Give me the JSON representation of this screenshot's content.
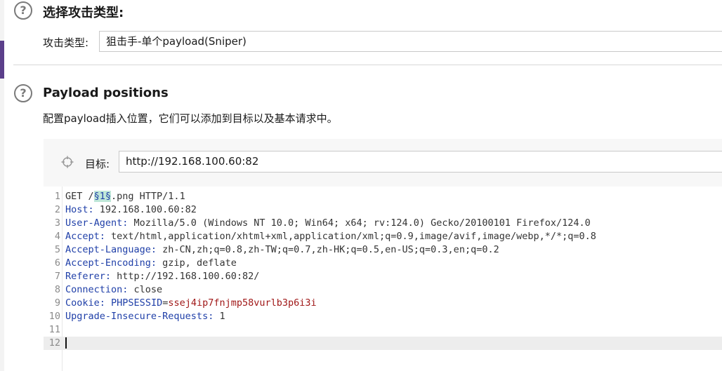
{
  "attack_type_section": {
    "title": "选择攻击类型:",
    "label": "攻击类型:",
    "selected": "狙击手-单个payload(Sniper)",
    "help_glyph": "?"
  },
  "positions_section": {
    "title": "Payload positions",
    "description": "配置payload插入位置，它们可以添加到目标以及基本请求中。",
    "help_glyph": "?",
    "target_label": "目标:",
    "target_value": "http://192.168.100.60:82"
  },
  "request_lines": [
    {
      "n": "1",
      "parts": [
        {
          "t": "GET /",
          "c": "plain"
        },
        {
          "t": "§1§",
          "c": "marker"
        },
        {
          "t": ".png HTTP/1.1",
          "c": "plain"
        }
      ]
    },
    {
      "n": "2",
      "parts": [
        {
          "t": "Host:",
          "c": "hk"
        },
        {
          "t": " 192.168.100.60:82",
          "c": "hv"
        }
      ]
    },
    {
      "n": "3",
      "parts": [
        {
          "t": "User-Agent:",
          "c": "hk"
        },
        {
          "t": " Mozilla/5.0 (Windows NT 10.0; Win64; x64; rv:124.0) Gecko/20100101 Firefox/124.0",
          "c": "hv"
        }
      ]
    },
    {
      "n": "4",
      "parts": [
        {
          "t": "Accept:",
          "c": "hk"
        },
        {
          "t": " text/html,application/xhtml+xml,application/xml;q=0.9,image/avif,image/webp,*/*;q=0.8",
          "c": "hv"
        }
      ]
    },
    {
      "n": "5",
      "parts": [
        {
          "t": "Accept-Language:",
          "c": "hk"
        },
        {
          "t": " zh-CN,zh;q=0.8,zh-TW;q=0.7,zh-HK;q=0.5,en-US;q=0.3,en;q=0.2",
          "c": "hv"
        }
      ]
    },
    {
      "n": "6",
      "parts": [
        {
          "t": "Accept-Encoding:",
          "c": "hk"
        },
        {
          "t": " gzip, deflate",
          "c": "hv"
        }
      ]
    },
    {
      "n": "7",
      "parts": [
        {
          "t": "Referer:",
          "c": "hk"
        },
        {
          "t": " http://192.168.100.60:82/",
          "c": "hv"
        }
      ]
    },
    {
      "n": "8",
      "parts": [
        {
          "t": "Connection:",
          "c": "hk"
        },
        {
          "t": " close",
          "c": "hv"
        }
      ]
    },
    {
      "n": "9",
      "parts": [
        {
          "t": "Cookie:",
          "c": "hk"
        },
        {
          "t": " ",
          "c": "hv"
        },
        {
          "t": "PHPSESSID",
          "c": "ck-name"
        },
        {
          "t": "=",
          "c": "hv"
        },
        {
          "t": "ssej4ip7fnjmp58vurlb3p6i3i",
          "c": "ck-val"
        }
      ]
    },
    {
      "n": "10",
      "parts": [
        {
          "t": "Upgrade-Insecure-Requests:",
          "c": "hk"
        },
        {
          "t": " 1",
          "c": "hv"
        }
      ]
    },
    {
      "n": "11",
      "parts": []
    },
    {
      "n": "12",
      "parts": [],
      "active": true
    }
  ],
  "colors": {
    "accent": "#5b3f8a",
    "header_key": "#1f3fa8",
    "cookie_value": "#a01818",
    "marker_bg": "#bfe7d8"
  },
  "icons": {
    "help": "help-circle-icon",
    "target": "crosshair-icon"
  }
}
